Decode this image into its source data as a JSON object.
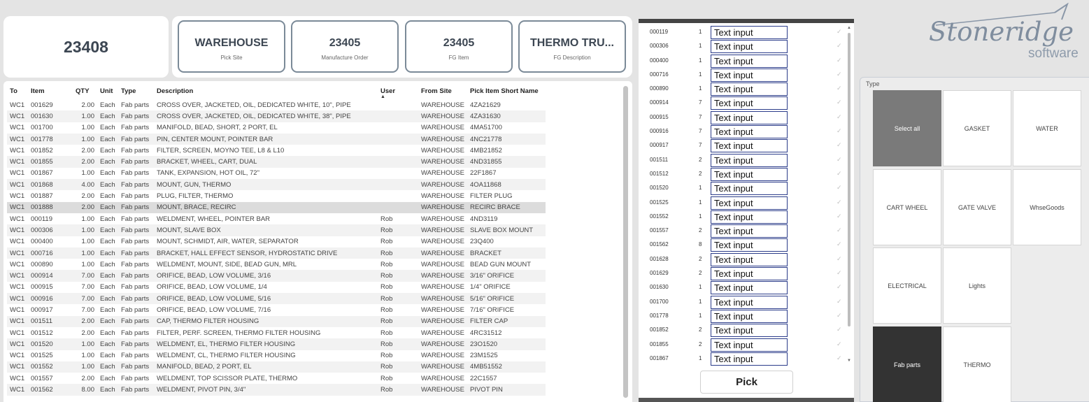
{
  "header": {
    "main_value": "23408",
    "cards": [
      {
        "value": "WAREHOUSE",
        "label": "Pick Site"
      },
      {
        "value": "23405",
        "label": "Manufacture Order"
      },
      {
        "value": "23405",
        "label": "FG Item"
      },
      {
        "value": "THERMO TRU...",
        "label": "FG Description"
      }
    ]
  },
  "table": {
    "columns": [
      "To",
      "Item",
      "QTY",
      "Unit",
      "Type",
      "Description",
      "User",
      "From Site",
      "Pick Item Short Name"
    ],
    "sort_arrow": "▲",
    "rows": [
      [
        "WC1",
        "001629",
        "2.00",
        "Each",
        "Fab parts",
        "CROSS OVER, JACKETED, OIL, DEDICATED WHITE, 10\", PIPE",
        "",
        "WAREHOUSE",
        "4ZA21629"
      ],
      [
        "WC1",
        "001630",
        "1.00",
        "Each",
        "Fab parts",
        "CROSS OVER, JACKETED, OIL, DEDICATED WHITE, 38\", PIPE",
        "",
        "WAREHOUSE",
        "4ZA31630"
      ],
      [
        "WC1",
        "001700",
        "1.00",
        "Each",
        "Fab parts",
        "MANIFOLD, BEAD, SHORT, 2 PORT, EL",
        "",
        "WAREHOUSE",
        "4MA51700"
      ],
      [
        "WC1",
        "001778",
        "1.00",
        "Each",
        "Fab parts",
        "PIN, CENTER MOUNT, POINTER BAR",
        "",
        "WAREHOUSE",
        "4NC21778"
      ],
      [
        "WC1",
        "001852",
        "2.00",
        "Each",
        "Fab parts",
        "FILTER, SCREEN, MOYNO TEE, L8 & L10",
        "",
        "WAREHOUSE",
        "4MB21852"
      ],
      [
        "WC1",
        "001855",
        "2.00",
        "Each",
        "Fab parts",
        "BRACKET, WHEEL, CART, DUAL",
        "",
        "WAREHOUSE",
        "4ND31855"
      ],
      [
        "WC1",
        "001867",
        "1.00",
        "Each",
        "Fab parts",
        "TANK, EXPANSION, HOT OIL, 72\"",
        "",
        "WAREHOUSE",
        "22F1867"
      ],
      [
        "WC1",
        "001868",
        "4.00",
        "Each",
        "Fab parts",
        "MOUNT, GUN, THERMO",
        "",
        "WAREHOUSE",
        "4OA11868"
      ],
      [
        "WC1",
        "001887",
        "2.00",
        "Each",
        "Fab parts",
        "PLUG, FILTER, THERMO",
        "",
        "WAREHOUSE",
        "FILTER PLUG"
      ],
      [
        "WC1",
        "001888",
        "2.00",
        "Each",
        "Fab parts",
        "MOUNT, BRACE, RECIRC",
        "",
        "WAREHOUSE",
        "RECIRC BRACE"
      ],
      [
        "WC1",
        "000119",
        "1.00",
        "Each",
        "Fab parts",
        "WELDMENT, WHEEL, POINTER BAR",
        "Rob",
        "WAREHOUSE",
        "4ND3119"
      ],
      [
        "WC1",
        "000306",
        "1.00",
        "Each",
        "Fab parts",
        "MOUNT, SLAVE BOX",
        "Rob",
        "WAREHOUSE",
        "SLAVE BOX MOUNT"
      ],
      [
        "WC1",
        "000400",
        "1.00",
        "Each",
        "Fab parts",
        "MOUNT, SCHMIDT, AIR, WATER, SEPARATOR",
        "Rob",
        "WAREHOUSE",
        "23Q400"
      ],
      [
        "WC1",
        "000716",
        "1.00",
        "Each",
        "Fab parts",
        "BRACKET, HALL EFFECT SENSOR, HYDROSTATIC DRIVE",
        "Rob",
        "WAREHOUSE",
        "BRACKET"
      ],
      [
        "WC1",
        "000890",
        "1.00",
        "Each",
        "Fab parts",
        "WELDMENT, MOUNT, SIDE, BEAD GUN, MRL",
        "Rob",
        "WAREHOUSE",
        "BEAD GUN MOUNT"
      ],
      [
        "WC1",
        "000914",
        "7.00",
        "Each",
        "Fab parts",
        "ORIFICE, BEAD, LOW VOLUME, 3/16",
        "Rob",
        "WAREHOUSE",
        "3/16\" ORIFICE"
      ],
      [
        "WC1",
        "000915",
        "7.00",
        "Each",
        "Fab parts",
        "ORIFICE, BEAD, LOW VOLUME, 1/4",
        "Rob",
        "WAREHOUSE",
        "1/4\" ORIFICE"
      ],
      [
        "WC1",
        "000916",
        "7.00",
        "Each",
        "Fab parts",
        "ORIFICE, BEAD, LOW VOLUME, 5/16",
        "Rob",
        "WAREHOUSE",
        "5/16\" ORIFICE"
      ],
      [
        "WC1",
        "000917",
        "7.00",
        "Each",
        "Fab parts",
        "ORIFICE, BEAD, LOW VOLUME, 7/16",
        "Rob",
        "WAREHOUSE",
        "7/16\" ORIFICE"
      ],
      [
        "WC1",
        "001511",
        "2.00",
        "Each",
        "Fab parts",
        "CAP, THERMO FILTER HOUSING",
        "Rob",
        "WAREHOUSE",
        "FILTER CAP"
      ],
      [
        "WC1",
        "001512",
        "2.00",
        "Each",
        "Fab parts",
        "FILTER, PERF. SCREEN, THERMO FILTER HOUSING",
        "Rob",
        "WAREHOUSE",
        "4RC31512"
      ],
      [
        "WC1",
        "001520",
        "1.00",
        "Each",
        "Fab parts",
        "WELDMENT, EL, THERMO FILTER HOUSING",
        "Rob",
        "WAREHOUSE",
        "23O1520"
      ],
      [
        "WC1",
        "001525",
        "1.00",
        "Each",
        "Fab parts",
        "WELDMENT, CL, THERMO FILTER HOUSING",
        "Rob",
        "WAREHOUSE",
        "23M1525"
      ],
      [
        "WC1",
        "001552",
        "1.00",
        "Each",
        "Fab parts",
        "MANIFOLD, BEAD, 2 PORT, EL",
        "Rob",
        "WAREHOUSE",
        "4MB51552"
      ],
      [
        "WC1",
        "001557",
        "2.00",
        "Each",
        "Fab parts",
        "WELDMENT, TOP SCISSOR PLATE, THERMO",
        "Rob",
        "WAREHOUSE",
        "22C1557"
      ],
      [
        "WC1",
        "001562",
        "8.00",
        "Each",
        "Fab parts",
        "WELDMENT, PIVOT PIN, 3/4\"",
        "Rob",
        "WAREHOUSE",
        "PIVOT PIN"
      ]
    ]
  },
  "pick": {
    "input_value": "Text input",
    "check_glyph": "✓",
    "button_label": "Pick",
    "rows": [
      {
        "code": "000119",
        "qty": "1"
      },
      {
        "code": "000306",
        "qty": "1"
      },
      {
        "code": "000400",
        "qty": "1"
      },
      {
        "code": "000716",
        "qty": "1"
      },
      {
        "code": "000890",
        "qty": "1"
      },
      {
        "code": "000914",
        "qty": "7"
      },
      {
        "code": "000915",
        "qty": "7"
      },
      {
        "code": "000916",
        "qty": "7"
      },
      {
        "code": "000917",
        "qty": "7"
      },
      {
        "code": "001511",
        "qty": "2"
      },
      {
        "code": "001512",
        "qty": "2"
      },
      {
        "code": "001520",
        "qty": "1"
      },
      {
        "code": "001525",
        "qty": "1"
      },
      {
        "code": "001552",
        "qty": "1"
      },
      {
        "code": "001557",
        "qty": "2"
      },
      {
        "code": "001562",
        "qty": "8"
      },
      {
        "code": "001628",
        "qty": "2"
      },
      {
        "code": "001629",
        "qty": "2"
      },
      {
        "code": "001630",
        "qty": "1"
      },
      {
        "code": "001700",
        "qty": "1"
      },
      {
        "code": "001778",
        "qty": "1"
      },
      {
        "code": "001852",
        "qty": "2"
      },
      {
        "code": "001855",
        "qty": "2"
      },
      {
        "code": "001867",
        "qty": "1"
      }
    ]
  },
  "logo": {
    "word": "Stoneridge",
    "sub": "software"
  },
  "slicer": {
    "title": "Type",
    "options": [
      "Select all",
      "GASKET",
      "WATER",
      "CART WHEEL",
      "GATE VALVE",
      "WhseGoods",
      "ELECTRICAL",
      "Lights",
      "Fab parts",
      "THERMO"
    ],
    "selected": "Fab parts"
  },
  "colors": {
    "accent": "#7b8a98",
    "input_border": "#2b3c8a",
    "tile_selected": "#333333",
    "tile_select_all": "#7a7a7a"
  }
}
